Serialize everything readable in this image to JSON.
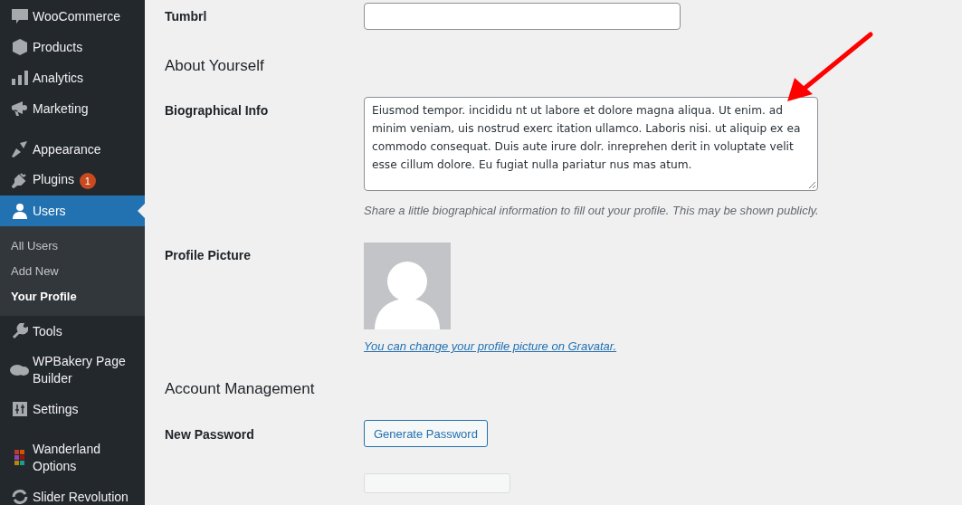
{
  "sidebar": {
    "groups": [
      [
        {
          "label": "WooCommerce",
          "selected": false
        },
        {
          "label": "Products",
          "selected": false
        },
        {
          "label": "Analytics",
          "selected": false
        },
        {
          "label": "Marketing",
          "selected": false
        }
      ],
      [
        {
          "label": "Appearance",
          "selected": false
        },
        {
          "label": "Plugins",
          "selected": false,
          "badge": "1"
        },
        {
          "label": "Users",
          "selected": true,
          "children": [
            {
              "label": "All Users",
              "selected": false
            },
            {
              "label": "Add New",
              "selected": false
            },
            {
              "label": "Your Profile",
              "selected": true
            }
          ]
        },
        {
          "label": "Tools",
          "selected": false
        },
        {
          "label": "WPBakery Page Builder",
          "selected": false
        },
        {
          "label": "Settings",
          "selected": false
        }
      ],
      [
        {
          "label": "Wanderland Options",
          "selected": false
        },
        {
          "label": "Slider Revolution",
          "selected": false
        }
      ]
    ]
  },
  "form": {
    "rows": [
      {
        "kind": "input",
        "label": "Tumbrl"
      },
      {
        "kind": "heading",
        "label": "About Yourself"
      },
      {
        "kind": "textarea",
        "label": "Biographical Info",
        "value": "Eiusmod tempor. incididu nt ut labore et dolore magna aliqua. Ut enim. ad minim veniam, uis nostrud exerc itation ullamco. Laboris nisi. ut aliquip ex ea commodo consequat. Duis aute irure dolr. inreprehen derit in voluptate velit esse cillum dolore. Eu fugiat nulla pariatur nus mas atum.",
        "description": "Share a little biographical information to fill out your profile. This may be shown publicly."
      },
      {
        "kind": "avatar",
        "label": "Profile Picture",
        "link": "You can change your profile picture on Gravatar."
      },
      {
        "kind": "heading",
        "label": "Account Management"
      },
      {
        "kind": "button",
        "label": "New Password",
        "button": "Generate Password"
      },
      {
        "kind": "partial"
      }
    ]
  }
}
